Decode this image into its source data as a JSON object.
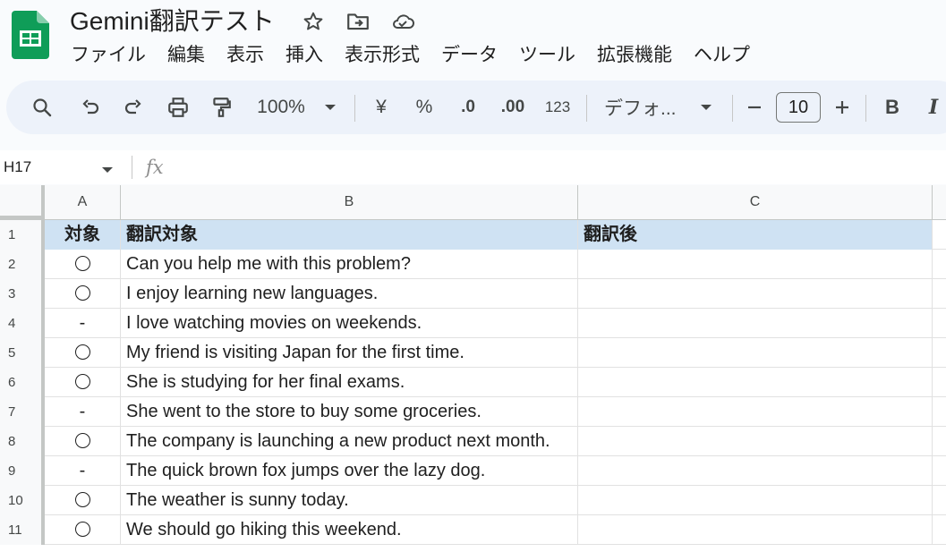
{
  "app": {
    "title": "Gemini翻訳テスト",
    "brand_color": "#0f9d58"
  },
  "menu": [
    "ファイル",
    "編集",
    "表示",
    "挿入",
    "表示形式",
    "データ",
    "ツール",
    "拡張機能",
    "ヘルプ"
  ],
  "toolbar": {
    "zoom": "100%",
    "currency": "¥",
    "percent": "%",
    "decrease_decimal": ".0",
    "increase_decimal": ".00",
    "number_format": "123",
    "font": "デフォ...",
    "font_size": "10",
    "bold": "B",
    "italic": "I"
  },
  "formula_bar": {
    "cell_ref": "H17",
    "fx": "fx"
  },
  "columns": [
    "A",
    "B",
    "C"
  ],
  "rows": [
    {
      "num": "1",
      "a": "対象",
      "b": "翻訳対象",
      "c": "翻訳後",
      "header": true
    },
    {
      "num": "2",
      "a": "circle",
      "b": "Can you help me with this problem?",
      "c": ""
    },
    {
      "num": "3",
      "a": "circle",
      "b": "I enjoy learning new languages.",
      "c": ""
    },
    {
      "num": "4",
      "a": "-",
      "b": "I love watching movies on weekends.",
      "c": ""
    },
    {
      "num": "5",
      "a": "circle",
      "b": "My friend is visiting Japan for the first time.",
      "c": ""
    },
    {
      "num": "6",
      "a": "circle",
      "b": "She is studying for her final exams.",
      "c": ""
    },
    {
      "num": "7",
      "a": "-",
      "b": "She went to the store to buy some groceries.",
      "c": ""
    },
    {
      "num": "8",
      "a": "circle",
      "b": "The company is launching a new product next month.",
      "c": ""
    },
    {
      "num": "9",
      "a": "-",
      "b": "The quick brown fox jumps over the lazy dog.",
      "c": ""
    },
    {
      "num": "10",
      "a": "circle",
      "b": "The weather is sunny today.",
      "c": ""
    },
    {
      "num": "11",
      "a": "circle",
      "b": "We should go hiking this weekend.",
      "c": ""
    }
  ]
}
